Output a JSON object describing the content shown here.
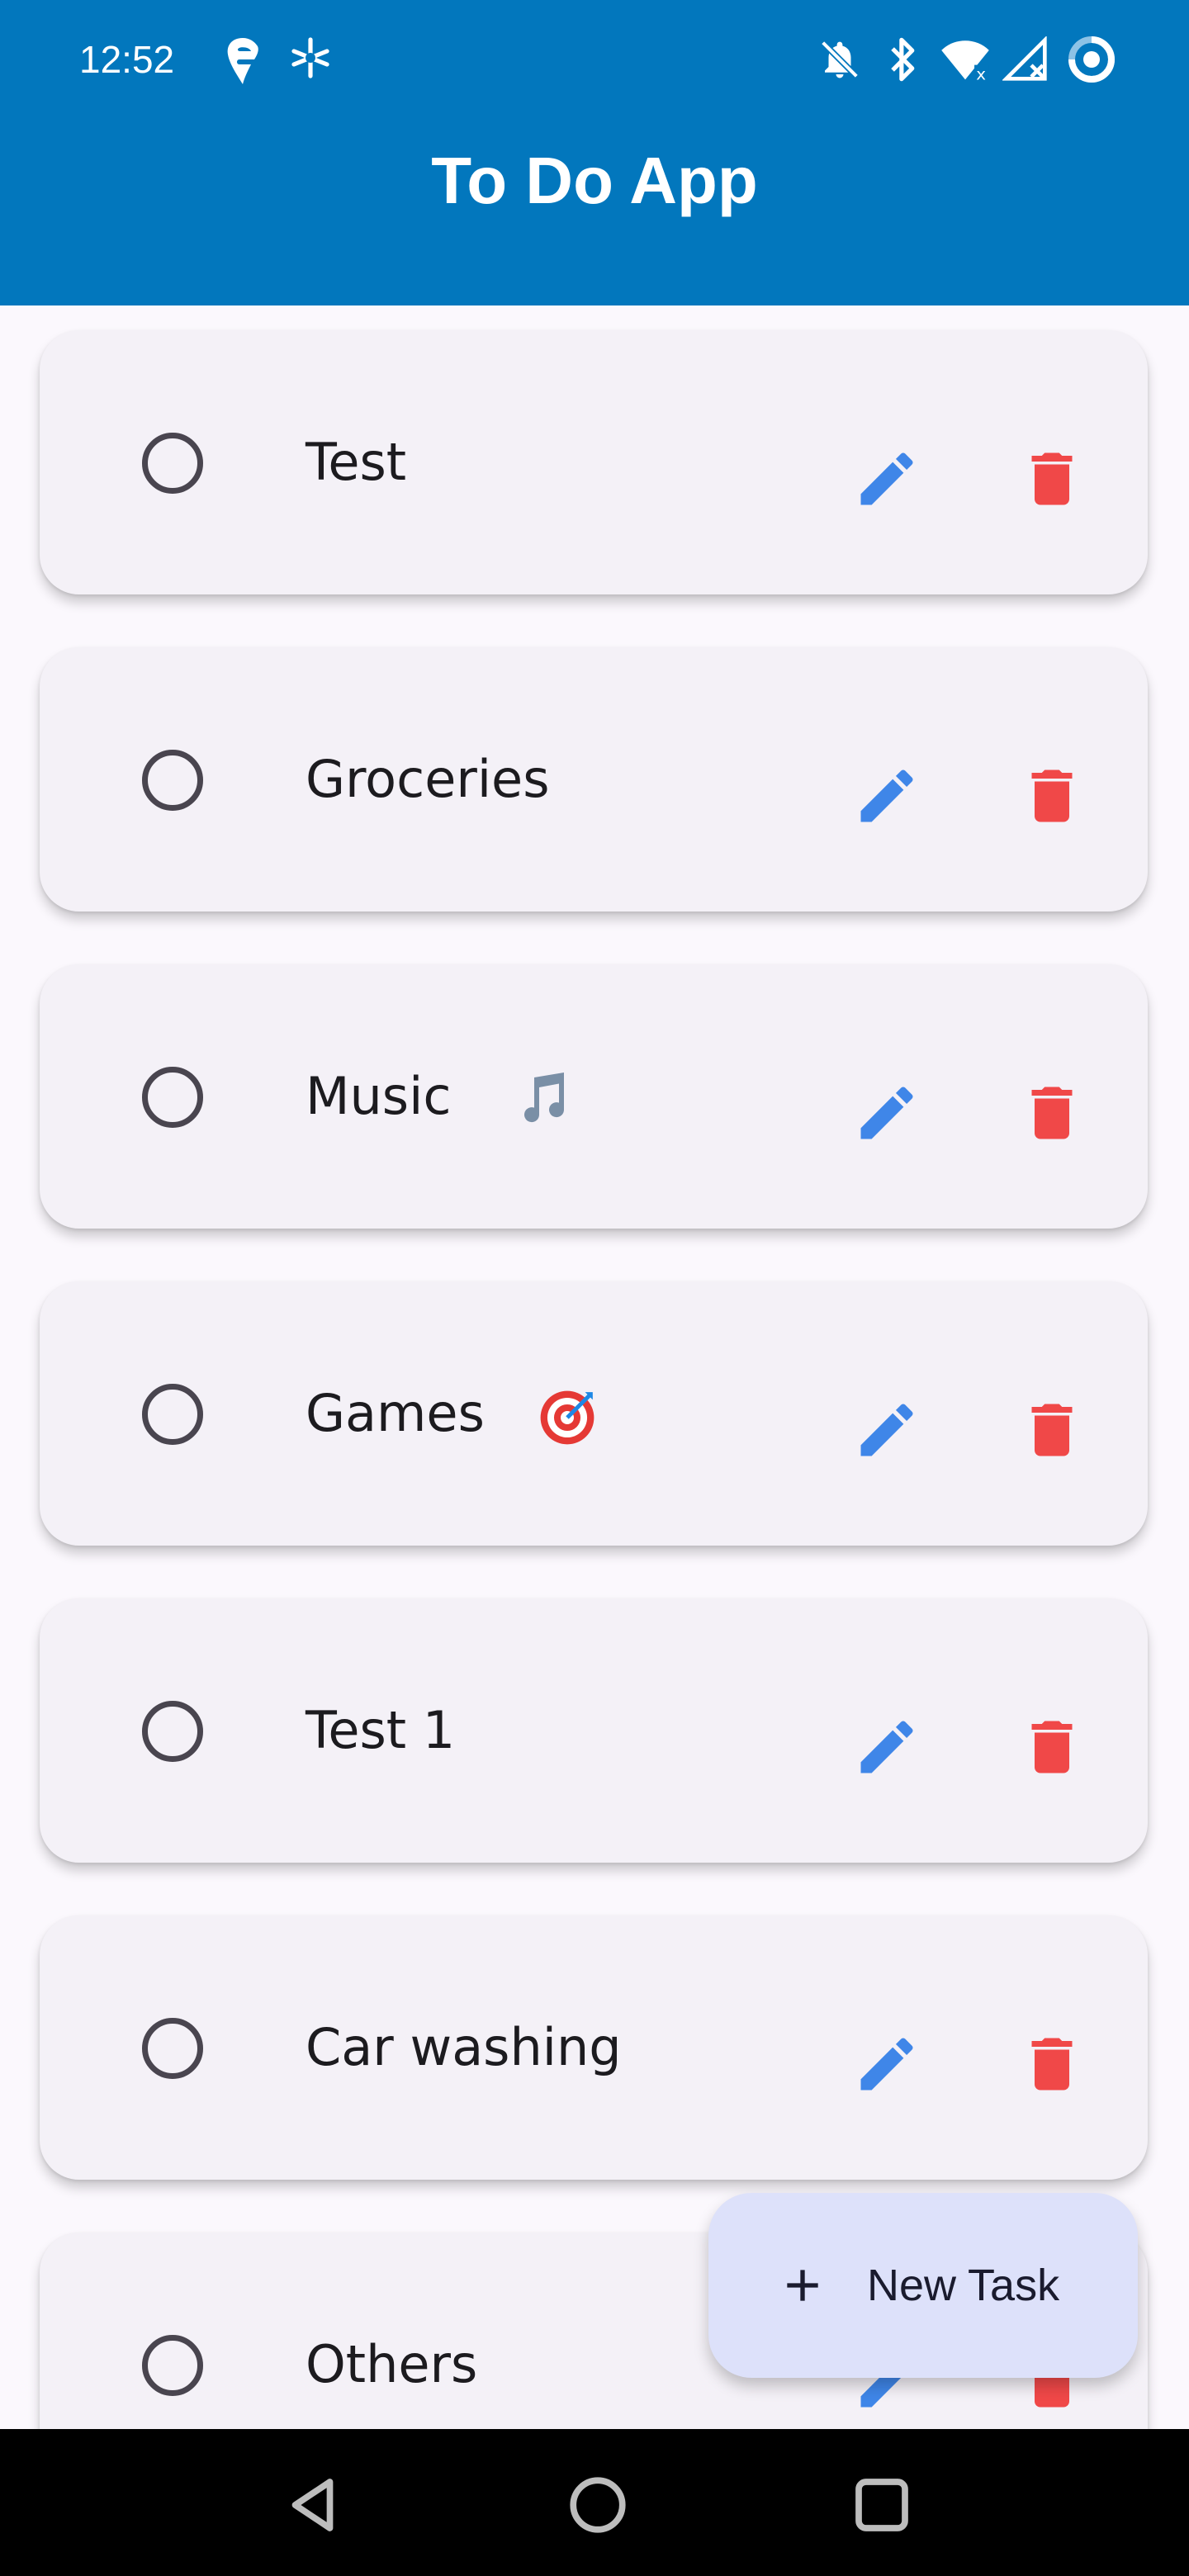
{
  "status_bar": {
    "time": "12:52",
    "left_icons": [
      "swiggy-icon",
      "sparkle-icon"
    ],
    "right_icons": [
      "bell-off-icon",
      "bluetooth-icon",
      "wifi-icon",
      "signal-off-icon",
      "battery-ring-icon"
    ]
  },
  "app_bar": {
    "title": "To Do App"
  },
  "tasks": [
    {
      "label": "Test",
      "emoji": ""
    },
    {
      "label": "Groceries",
      "emoji": ""
    },
    {
      "label": "Music",
      "emoji": "music-note-icon"
    },
    {
      "label": "Games",
      "emoji": "target-icon"
    },
    {
      "label": "Test 1",
      "emoji": ""
    },
    {
      "label": "Car washing",
      "emoji": ""
    },
    {
      "label": "Others",
      "emoji": ""
    }
  ],
  "fab": {
    "label": "New Task",
    "icon": "plus-icon"
  },
  "nav": {
    "icons": [
      "back-icon",
      "home-icon",
      "recents-icon"
    ]
  },
  "colors": {
    "app_bar": "#0277bd",
    "edit": "#3f86e8",
    "delete": "#f04848",
    "card": "#f4f1f7",
    "fab": "#dde1fa"
  }
}
